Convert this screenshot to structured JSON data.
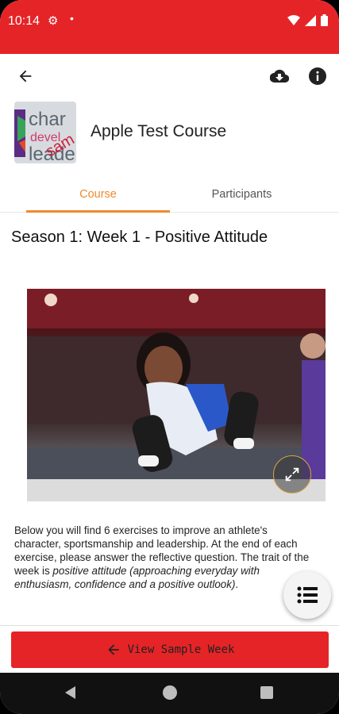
{
  "status_bar": {
    "time": "10:14"
  },
  "course": {
    "title": "Apple Test Course",
    "logo_lines": [
      "char",
      "devel",
      "leade"
    ],
    "logo_overlay": "sam"
  },
  "tabs": [
    {
      "label": "Course",
      "active": true
    },
    {
      "label": "Participants",
      "active": false
    }
  ],
  "week": {
    "title": "Season 1: Week 1 - Positive Attitude"
  },
  "description": {
    "part1": "Below you will find 6 exercises to improve an athlete's character, sportsmanship and leadership. At the end of each exercise, please answer the reflective question. The trait of the week is ",
    "italic": "positive attitude (approaching everyday with enthusiasm, confidence and a positive outlook)",
    "part2": "."
  },
  "cta": {
    "label": "View Sample Week"
  },
  "colors": {
    "primary": "#e52427",
    "accent": "#ef8a2f"
  },
  "icons": [
    "back-arrow-icon",
    "cloud-download-icon",
    "info-icon",
    "expand-icon",
    "list-icon",
    "arrow-left-icon"
  ]
}
